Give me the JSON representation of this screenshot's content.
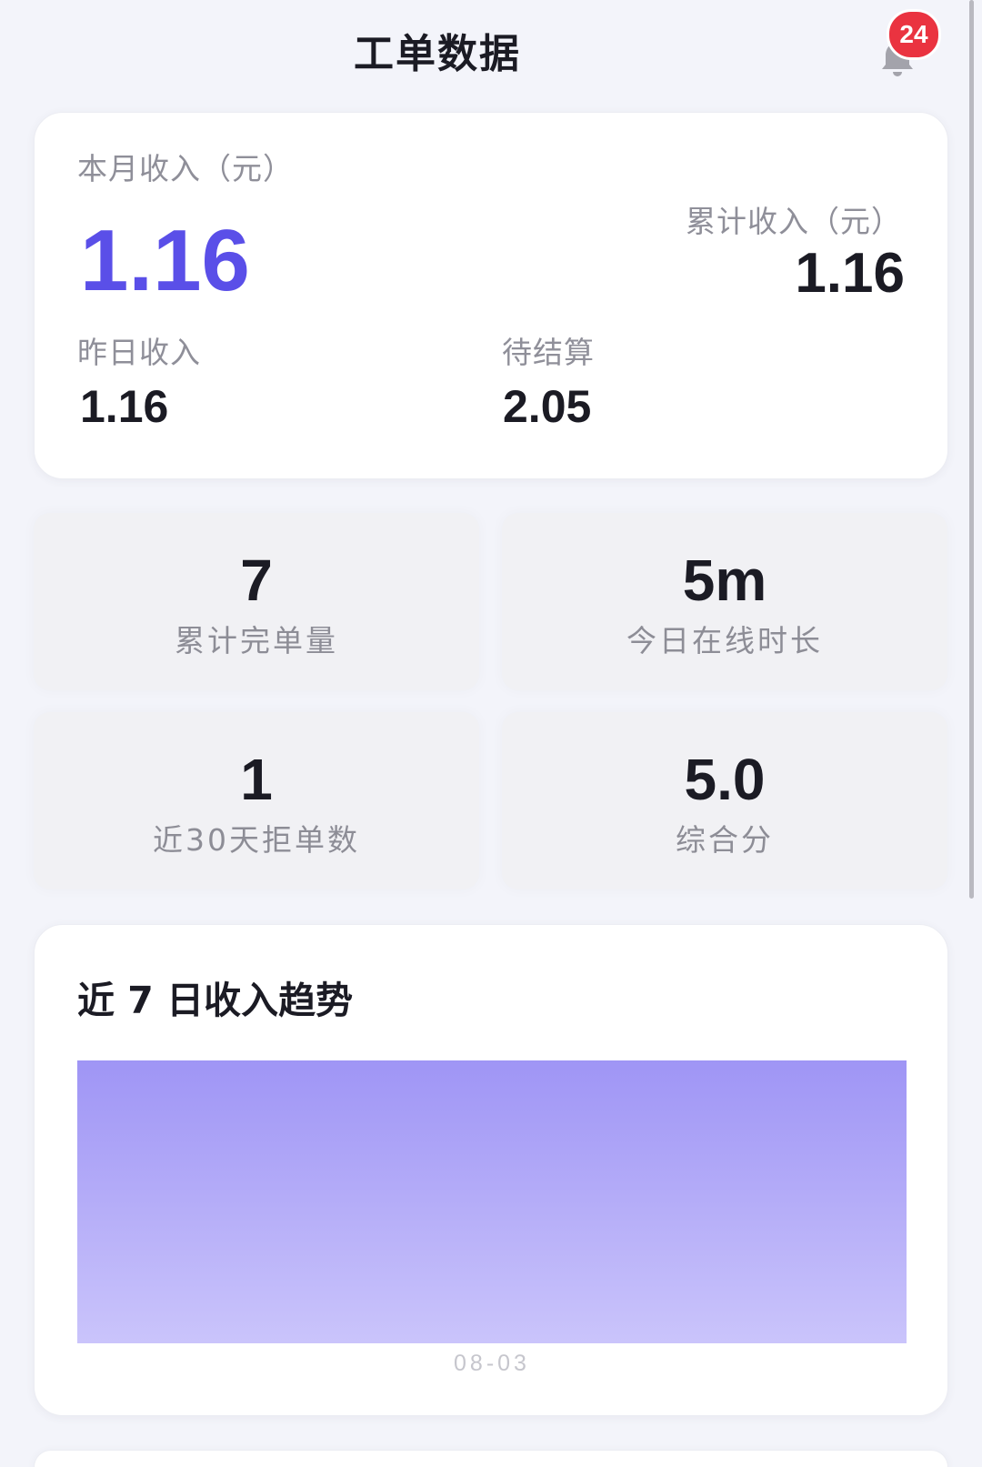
{
  "header": {
    "title": "工单数据",
    "notification_count": "24"
  },
  "icons": {
    "notifications": "bell-icon"
  },
  "income": {
    "month_label": "本月收入（元）",
    "month_value": "1.16",
    "total_label": "累计收入（元）",
    "total_value": "1.16",
    "yesterday_label": "昨日收入",
    "yesterday_value": "1.16",
    "pending_label": "待结算",
    "pending_value": "2.05"
  },
  "stats": [
    {
      "value": "7",
      "label": "累计完单量"
    },
    {
      "value": "5m",
      "label": "今日在线时长"
    },
    {
      "value": "1",
      "label": "近30天拒单数"
    },
    {
      "value": "5.0",
      "label": "综合分"
    }
  ],
  "colors": {
    "background": "#f3f4fa",
    "accent": "#5a4fe8",
    "badge": "#ea3340",
    "text": "#1b1b24",
    "muted": "#8f8f99"
  },
  "chart_data": {
    "type": "area",
    "title": "近 7 日收入趋势",
    "categories": [
      "08-03"
    ],
    "series": [
      {
        "values": [
          1.0
        ]
      }
    ],
    "ylim": [
      0,
      1.0
    ],
    "grid": false,
    "area_color_top": "#9f95f5",
    "area_color_bottom": "#cac4fb"
  }
}
